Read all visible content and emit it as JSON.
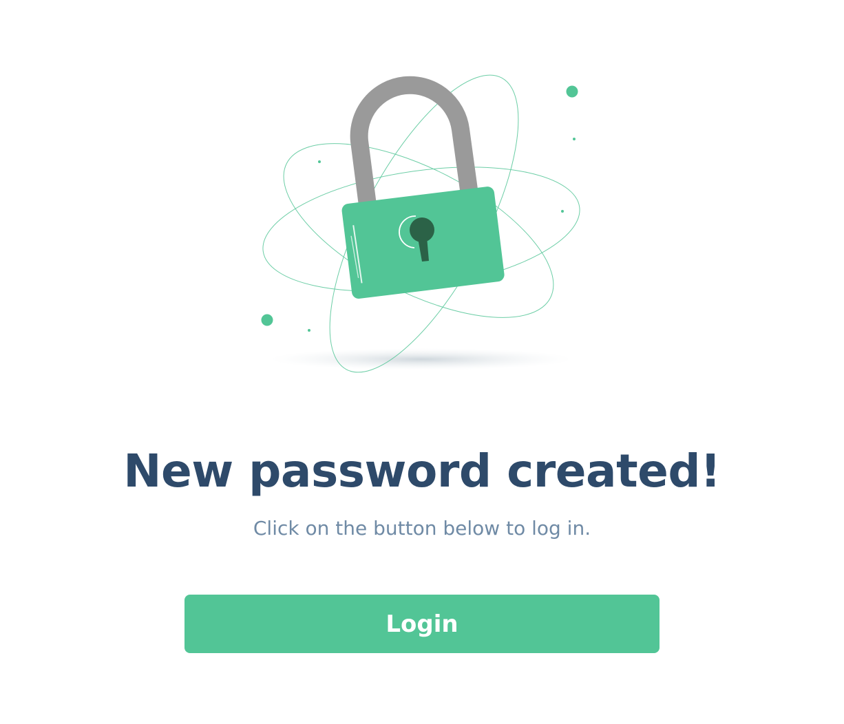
{
  "illustration": {
    "icon": "padlock-icon",
    "colors": {
      "lock_body": "#52c596",
      "shackle": "#9a9a9a",
      "keyhole": "#2b6247",
      "orbit": "#52c596"
    }
  },
  "heading": {
    "title": "New password created!",
    "subtitle": "Click on the button below to log in."
  },
  "actions": {
    "login_label": "Login"
  },
  "colors": {
    "accent": "#52c596",
    "title": "#2e4a6a",
    "subtitle": "#6f8aa5"
  }
}
